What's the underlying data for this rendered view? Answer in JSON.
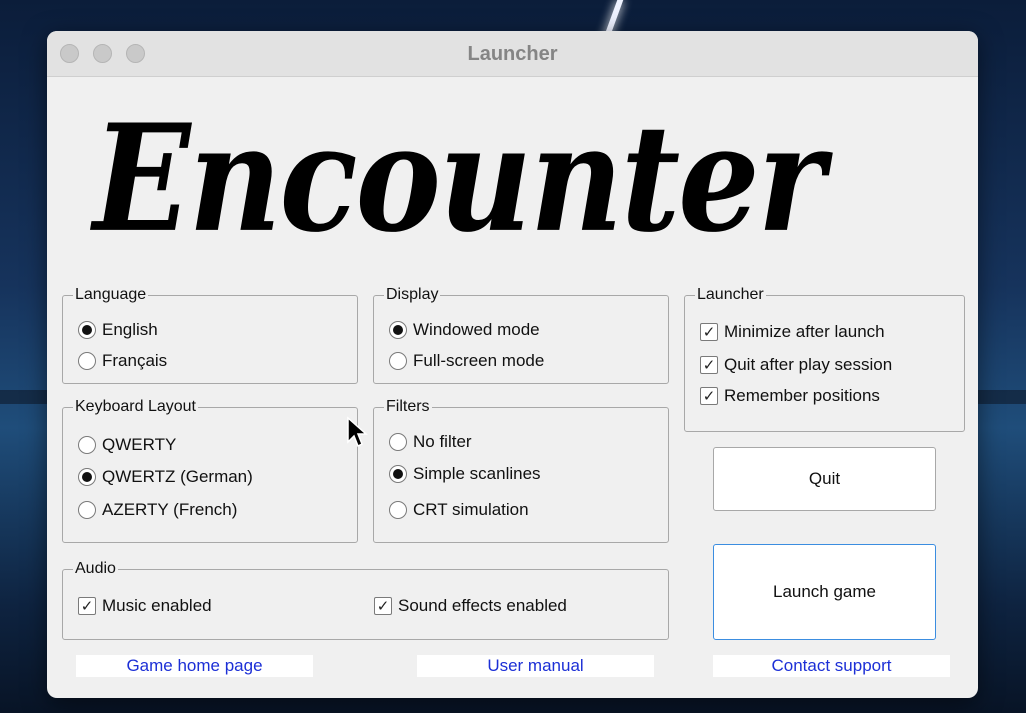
{
  "window": {
    "title": "Launcher"
  },
  "logo": {
    "text": "Encounter"
  },
  "language": {
    "title": "Language",
    "options": [
      {
        "label": "English",
        "selected": true
      },
      {
        "label": "Français",
        "selected": false
      }
    ]
  },
  "display": {
    "title": "Display",
    "options": [
      {
        "label": "Windowed mode",
        "selected": true
      },
      {
        "label": "Full-screen mode",
        "selected": false
      }
    ]
  },
  "launcher": {
    "title": "Launcher",
    "options": [
      {
        "label": "Minimize after launch",
        "checked": true
      },
      {
        "label": "Quit after play session",
        "checked": true
      },
      {
        "label": "Remember positions",
        "checked": true
      }
    ]
  },
  "keyboard": {
    "title": "Keyboard Layout",
    "options": [
      {
        "label": "QWERTY",
        "selected": false
      },
      {
        "label": "QWERTZ (German)",
        "selected": true
      },
      {
        "label": "AZERTY (French)",
        "selected": false
      }
    ]
  },
  "filters": {
    "title": "Filters",
    "options": [
      {
        "label": "No filter",
        "selected": false
      },
      {
        "label": "Simple scanlines",
        "selected": true
      },
      {
        "label": "CRT simulation",
        "selected": false
      }
    ]
  },
  "audio": {
    "title": "Audio",
    "options": [
      {
        "label": "Music enabled",
        "checked": true
      },
      {
        "label": "Sound effects enabled",
        "checked": true
      }
    ]
  },
  "buttons": {
    "quit": "Quit",
    "launch": "Launch game"
  },
  "links": {
    "home": "Game home page",
    "manual": "User manual",
    "support": "Contact support"
  },
  "icons": {
    "check": "✓",
    "traffic_lights": "traffic-light-icons",
    "cursor": "mouse-pointer-icon"
  },
  "colors": {
    "link": "#1c2fd6",
    "focus_border": "#3b8de0"
  }
}
